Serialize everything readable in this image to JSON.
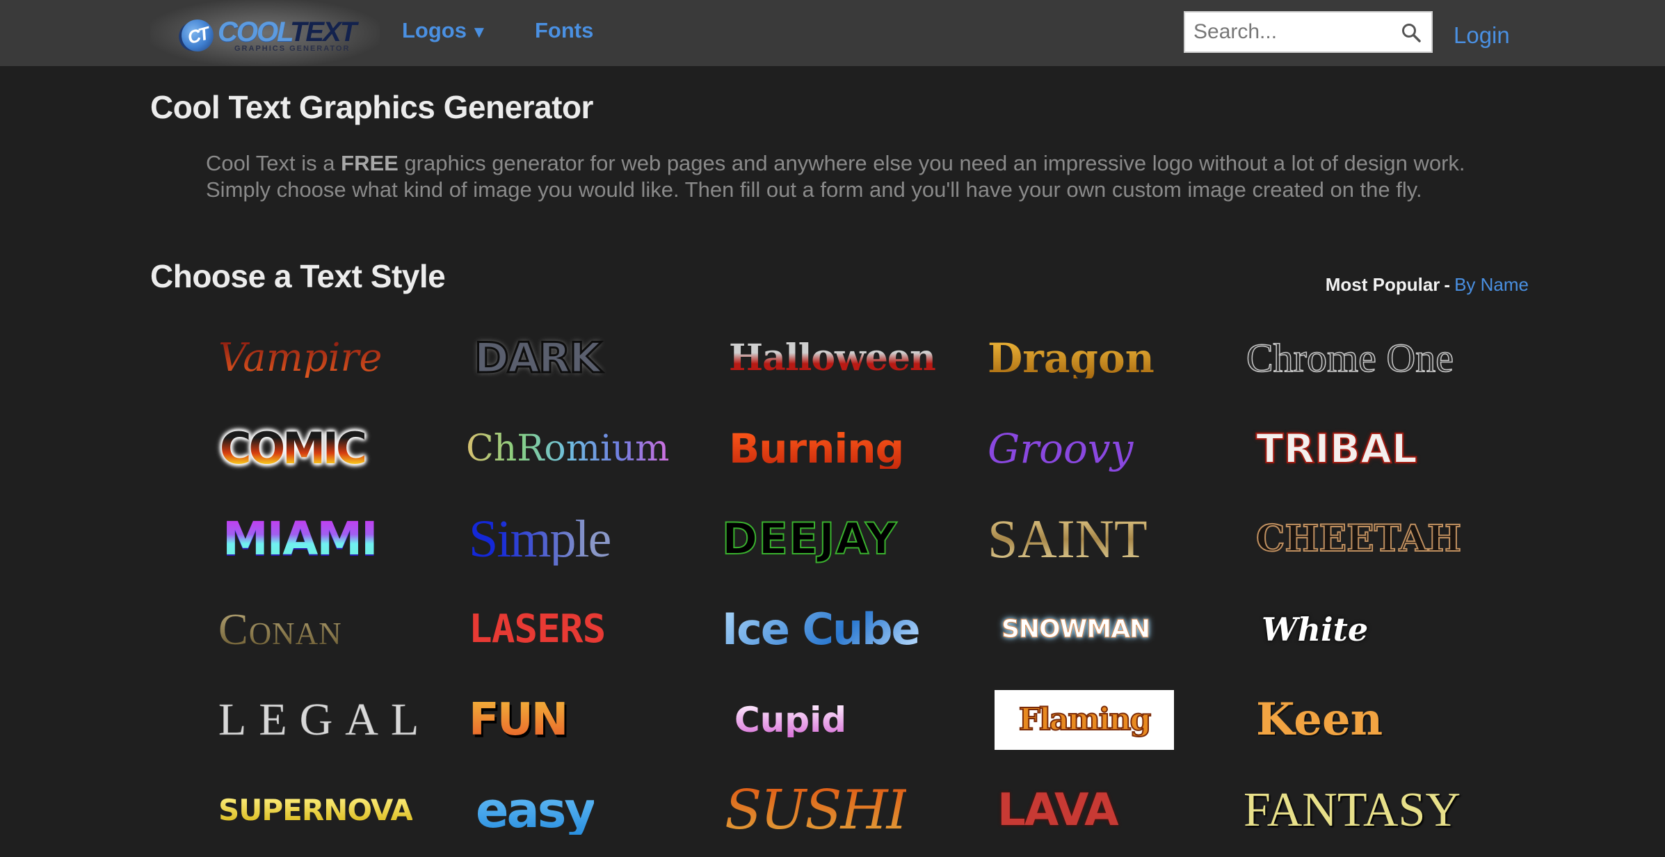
{
  "header": {
    "logo": {
      "badge": "CT",
      "word_cool": "COOL",
      "word_text": "TEXT",
      "subtitle": "GRAPHICS GENERATOR"
    },
    "nav": [
      {
        "label": "Logos",
        "caret": "▼"
      },
      {
        "label": "Fonts"
      }
    ],
    "search": {
      "placeholder": "Search...",
      "value": "",
      "icon": "search-icon"
    },
    "login_label": "Login"
  },
  "main": {
    "title": "Cool Text Graphics Generator",
    "intro": {
      "before_bold": "Cool Text is a ",
      "bold": "FREE",
      "after_bold": " graphics generator for web pages and anywhere else you need an impressive logo without a lot of design work. Simply choose what kind of image you would like. Then fill out a form and you'll have your own custom image created on the fly."
    },
    "section_title": "Choose a Text Style",
    "sort": {
      "current": "Most Popular",
      "separator": "-",
      "alternative": "By Name"
    },
    "styles": [
      {
        "name": "Vampire",
        "text": "Vampire"
      },
      {
        "name": "Dark",
        "text": "DARK"
      },
      {
        "name": "Halloween",
        "text": "Halloween"
      },
      {
        "name": "Dragon",
        "text": "Dragon"
      },
      {
        "name": "Chrome One",
        "text": "Chrome One"
      },
      {
        "name": "Comic",
        "text": "COMIC"
      },
      {
        "name": "Chromium",
        "text": "ChRomium"
      },
      {
        "name": "Burning",
        "text": "Burning"
      },
      {
        "name": "Groovy",
        "text": "Groovy"
      },
      {
        "name": "Tribal",
        "text": "TRIBAL"
      },
      {
        "name": "Miami",
        "text": "MIAMI"
      },
      {
        "name": "Simple",
        "text": "Simple"
      },
      {
        "name": "Deejay",
        "text": "DEEJAY"
      },
      {
        "name": "Saint",
        "text": "SAINT"
      },
      {
        "name": "Cheetah",
        "text": "CHEETAH"
      },
      {
        "name": "Conan",
        "text": "Conan"
      },
      {
        "name": "Lasers",
        "text": "LASERS"
      },
      {
        "name": "Ice Cube",
        "text": "Ice Cube"
      },
      {
        "name": "Snowman",
        "text": "SNOWMAN"
      },
      {
        "name": "White",
        "text": "White"
      },
      {
        "name": "Legal",
        "text": "LEGAL"
      },
      {
        "name": "Fun",
        "text": "FUN"
      },
      {
        "name": "Cupid",
        "text": "Cupid"
      },
      {
        "name": "Flaming",
        "text": "Flaming"
      },
      {
        "name": "Keen",
        "text": "Keen"
      },
      {
        "name": "Supernova",
        "text": "SUPERNOVA"
      },
      {
        "name": "Easy",
        "text": "easy"
      },
      {
        "name": "Sushi",
        "text": "SUSHI"
      },
      {
        "name": "Lava",
        "text": "LAVA"
      },
      {
        "name": "Fantasy",
        "text": "FANTASY"
      }
    ]
  },
  "colors": {
    "header_bg": "#3a3a3a",
    "page_bg": "#1f1f1f",
    "link": "#4a90e2",
    "heading": "#ececec",
    "body_text": "#8a8a8a"
  }
}
